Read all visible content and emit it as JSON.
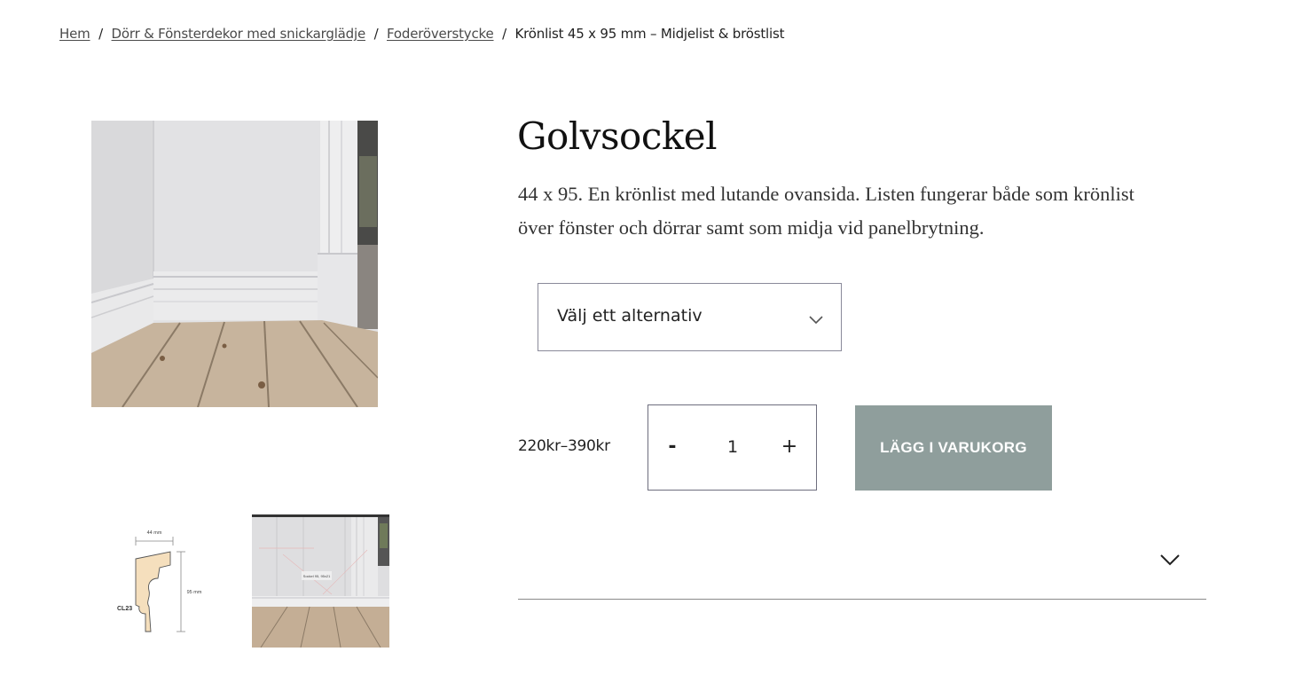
{
  "breadcrumb": {
    "home": "Hem",
    "separator": "/",
    "category": "Dörr & Fönsterdekor med snickarglädje",
    "subcategory": "Foderöverstycke",
    "current": "Krönlist 45 x 95 mm – Midjelist & bröstlist"
  },
  "product": {
    "title": "Golvsockel",
    "description": "44 x 95. En krönlist med lutande ovansida. Listen fungerar både som krönlist över fönster och dörrar samt som midja vid panelbrytning.",
    "price": "220kr–390kr"
  },
  "variant_select": {
    "selected": "Välj ett alternativ"
  },
  "quantity": {
    "minus_label": "-",
    "value": "1",
    "plus_label": "+"
  },
  "cart": {
    "add_label": "LÄGG I VARUKORG"
  },
  "thumbnails": {
    "profile_width_label": "44 mm",
    "profile_height_label": "95 mm",
    "profile_code": "CL23",
    "room_label": "Sockel 95, 95x21"
  },
  "colors": {
    "add_to_cart_bg": "#8f9e9c",
    "profile_fill": "#f5dfbd",
    "wall": "#e4e4e6",
    "floor": "#c9b6a0"
  },
  "icons": {
    "select_chevron": "chevron-down-icon",
    "accordion_chevron": "chevron-down-icon"
  }
}
